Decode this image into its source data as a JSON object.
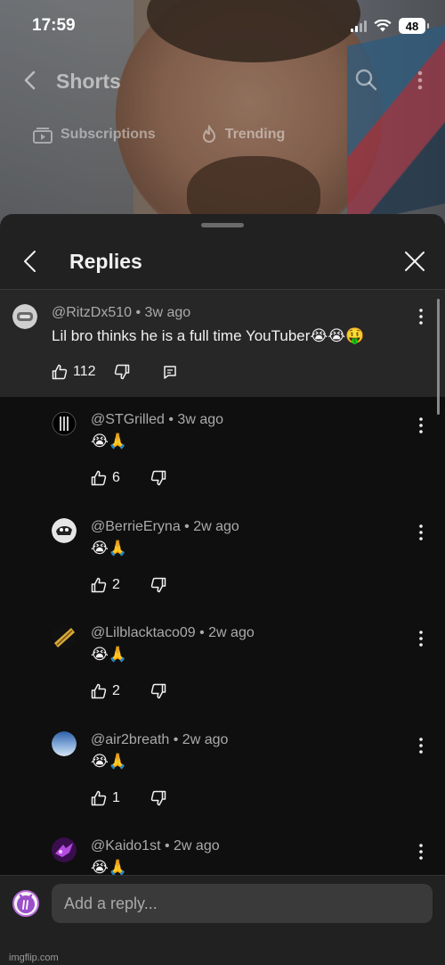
{
  "status_bar": {
    "time": "17:59",
    "battery": "48"
  },
  "background": {
    "title": "Shorts",
    "chips": [
      {
        "label": "Subscriptions",
        "icon": "subscriptions-icon"
      },
      {
        "label": "Trending",
        "icon": "flame-icon"
      }
    ]
  },
  "sheet": {
    "title": "Replies"
  },
  "parent_comment": {
    "author": "@RitzDx510",
    "age": "3w ago",
    "text": "Lil bro thinks he is a full time YouTuber😭😭🤑",
    "likes": "112"
  },
  "replies": [
    {
      "author": "@STGrilled",
      "age": "3w ago",
      "text": "😭🙏",
      "likes": "6"
    },
    {
      "author": "@BerrieEryna",
      "age": "2w ago",
      "text": "😭🙏",
      "likes": "2"
    },
    {
      "author": "@Lilblacktaco09",
      "age": "2w ago",
      "text": "😭🙏",
      "likes": "2"
    },
    {
      "author": "@air2breath",
      "age": "2w ago",
      "text": "😭🙏",
      "likes": "1"
    },
    {
      "author": "@Kaido1st",
      "age": "2w ago",
      "text": "😭🙏",
      "likes": ""
    }
  ],
  "composer": {
    "placeholder": "Add a reply..."
  },
  "watermark": "imgflip.com",
  "colors": {
    "sheet": "#212121",
    "list": "#0f0f0f",
    "highlight": "#272727",
    "meta": "#aaaaaa"
  }
}
